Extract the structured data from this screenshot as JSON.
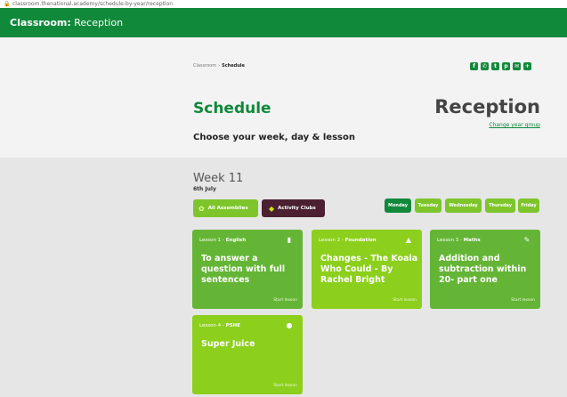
{
  "browser": {
    "url": "classroom.thenational.academy/schedule-by-year/reception"
  },
  "topbar": {
    "brand": "Classroom:",
    "section": "Reception"
  },
  "breadcrumb": {
    "root": "Classroom",
    "separator": "›",
    "current": "Schedule"
  },
  "social": {
    "icons": [
      "facebook-icon",
      "whatsapp-icon",
      "twitter-icon",
      "pinterest-icon",
      "email-icon",
      "share-icon"
    ]
  },
  "header": {
    "title": "Schedule",
    "subtitle": "Choose your week, day & lesson",
    "year": "Reception",
    "change_year": "Change year group"
  },
  "week": {
    "title": "Week 11",
    "date": "6th July"
  },
  "buttons": {
    "assemblies": "All Assemblies",
    "clubs": "Activity Clubs"
  },
  "days": [
    {
      "label": "Monday",
      "active": true
    },
    {
      "label": "Tuesday",
      "active": false
    },
    {
      "label": "Wednesday",
      "active": false
    },
    {
      "label": "Thursday",
      "active": false
    },
    {
      "label": "Friday",
      "active": false
    }
  ],
  "lessons": [
    {
      "label": "Lesson 1 - ",
      "subject": "English",
      "title": "To answer a question with full sentences",
      "start": "Start lesson",
      "icon": "book-icon"
    },
    {
      "label": "Lesson 2 - ",
      "subject": "Foundation",
      "title": "Changes - The Koala Who Could - By Rachel Bright",
      "start": "Start lesson",
      "icon": "lamp-icon"
    },
    {
      "label": "Lesson 3 - ",
      "subject": "Maths",
      "title": "Addition and subtraction within 20- part one",
      "start": "Start lesson",
      "icon": "ruler-pencil-icon"
    },
    {
      "label": "Lesson 4 - ",
      "subject": "PSHE",
      "title": "Super Juice",
      "start": "Start lesson",
      "icon": "cup-icon"
    }
  ],
  "colors": {
    "brand_green": "#11893b",
    "card_green": "#64b535",
    "card_lime": "#8ccf1c",
    "clubs_purple": "#4b2132"
  }
}
